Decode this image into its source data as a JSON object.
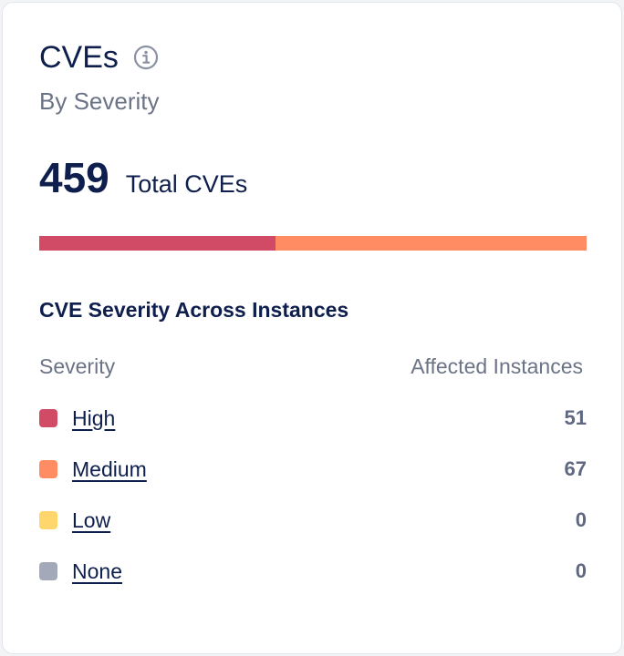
{
  "card": {
    "title": "CVEs",
    "info_icon": "info-icon",
    "subtitle": "By Severity",
    "total_value": "459",
    "total_label": "Total CVEs"
  },
  "severity_bar": {
    "segments": [
      {
        "name": "High",
        "count": 51,
        "color": "#d14a66"
      },
      {
        "name": "Medium",
        "count": 67,
        "color": "#ff8c62"
      },
      {
        "name": "Low",
        "count": 0,
        "color": "#ffd66b"
      },
      {
        "name": "None",
        "count": 0,
        "color": "#a3a9b8"
      }
    ]
  },
  "instances": {
    "title": "CVE Severity Across Instances",
    "col_severity": "Severity",
    "col_affected": "Affected Instances",
    "rows": [
      {
        "label": "High",
        "count": "51",
        "color": "#d14a66"
      },
      {
        "label": "Medium",
        "count": "67",
        "color": "#ff8c62"
      },
      {
        "label": "Low",
        "count": "0",
        "color": "#ffd66b"
      },
      {
        "label": "None",
        "count": "0",
        "color": "#a3a9b8"
      }
    ]
  }
}
